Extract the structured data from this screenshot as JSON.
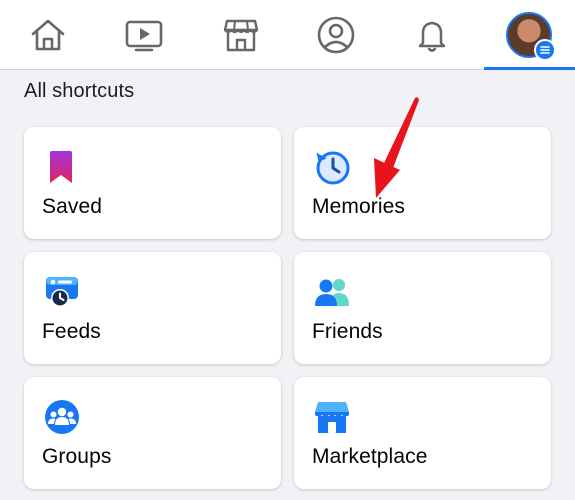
{
  "nav": {
    "tabs": [
      {
        "name": "home",
        "icon": "home-icon"
      },
      {
        "name": "watch",
        "icon": "video-play-icon"
      },
      {
        "name": "marketplace",
        "icon": "shop-icon"
      },
      {
        "name": "profile",
        "icon": "profile-circle-icon"
      },
      {
        "name": "notifications",
        "icon": "bell-icon"
      },
      {
        "name": "menu",
        "icon": "avatar-menu-icon",
        "active": true
      }
    ],
    "active_color": "#1877f2"
  },
  "shortcuts": {
    "title": "All shortcuts",
    "items": [
      {
        "label": "Saved",
        "icon": "bookmark-icon"
      },
      {
        "label": "Memories",
        "icon": "memories-clock-icon"
      },
      {
        "label": "Feeds",
        "icon": "feeds-icon"
      },
      {
        "label": "Friends",
        "icon": "friends-icon"
      },
      {
        "label": "Groups",
        "icon": "groups-icon"
      },
      {
        "label": "Marketplace",
        "icon": "marketplace-store-icon"
      }
    ]
  },
  "annotation": {
    "color": "#e8141b",
    "icon": "red-arrow"
  }
}
